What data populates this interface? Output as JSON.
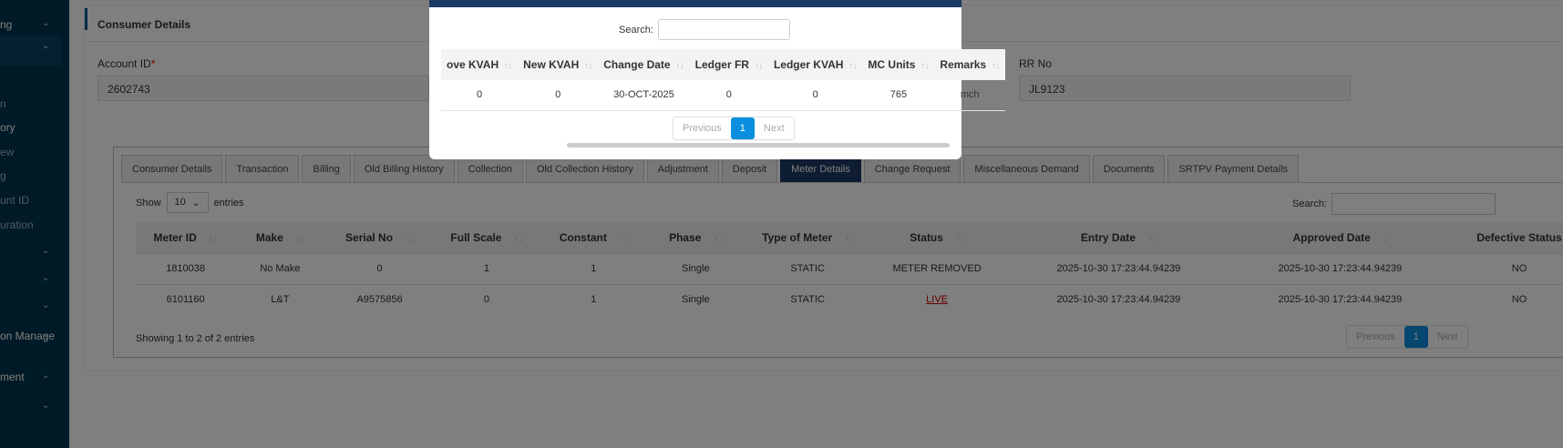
{
  "sidebar": {
    "items": [
      {
        "label": "ng",
        "chev": "⌄"
      },
      {
        "label": "",
        "chev": "⌃"
      },
      {
        "label": "n"
      },
      {
        "label": "ory"
      },
      {
        "label": "ew"
      },
      {
        "label": "g"
      },
      {
        "label": "unt ID"
      },
      {
        "label": "uration"
      },
      {
        "label": "",
        "chev": "⌄"
      },
      {
        "label": "",
        "chev": "⌄"
      },
      {
        "label": "",
        "chev": "⌄"
      },
      {
        "label": "on Manage",
        "chev": "⌄"
      },
      {
        "label": "ment",
        "chev": "⌄"
      },
      {
        "label": "",
        "chev": "⌄"
      }
    ]
  },
  "card": {
    "title": "Consumer Details",
    "account_label": "Account ID",
    "required": "*",
    "account_value": "2602743",
    "rr_label": "RR No",
    "rr_value": "JL9123"
  },
  "tabs": [
    "Consumer Details",
    "Transaction",
    "Billing",
    "Old Billing History",
    "Collection",
    "Old Collection History",
    "Adjustment",
    "Deposit",
    "Meter Details",
    "Change Request",
    "Miscellaneous Demand",
    "Documents",
    "SRTPV Payment Details"
  ],
  "active_tab": "Meter Details",
  "meter_table": {
    "show": "Show",
    "page_size": "10",
    "entries": "entries",
    "search_label": "Search:",
    "columns": [
      "Meter ID",
      "Make",
      "Serial No",
      "Full Scale",
      "Constant",
      "Phase",
      "Type of Meter",
      "Status",
      "Entry Date",
      "Approved Date",
      "Defective Status"
    ],
    "rows": [
      [
        "1810038",
        "No Make",
        "0",
        "1",
        "1",
        "Single",
        "STATIC",
        "METER REMOVED",
        "2025-10-30 17:23:44.94239",
        "2025-10-30 17:23:44.94239",
        "NO"
      ],
      [
        "6101160",
        "L&T",
        "A9575856",
        "0",
        "1",
        "Single",
        "STATIC",
        "LIVE",
        "2025-10-30 17:23:44.94239",
        "2025-10-30 17:23:44.94239",
        "NO"
      ]
    ],
    "info": "Showing 1 to 2 of 2 entries",
    "prev": "Previous",
    "page": "1",
    "next": "Next"
  },
  "modal": {
    "search_label": "Search:",
    "columns": [
      "ove KVAH",
      "New KVAH",
      "Change Date",
      "Ledger FR",
      "Ledger KVAH",
      "MC Units",
      "Remarks"
    ],
    "row": [
      "0",
      "0",
      "30-OCT-2025",
      "0",
      "0",
      "765",
      "mch"
    ],
    "prev": "Previous",
    "page": "1",
    "next": "Next"
  },
  "colors": {
    "accent": "#1c3a63",
    "page_active": "#0a8fe0",
    "live": "#cc0000"
  }
}
